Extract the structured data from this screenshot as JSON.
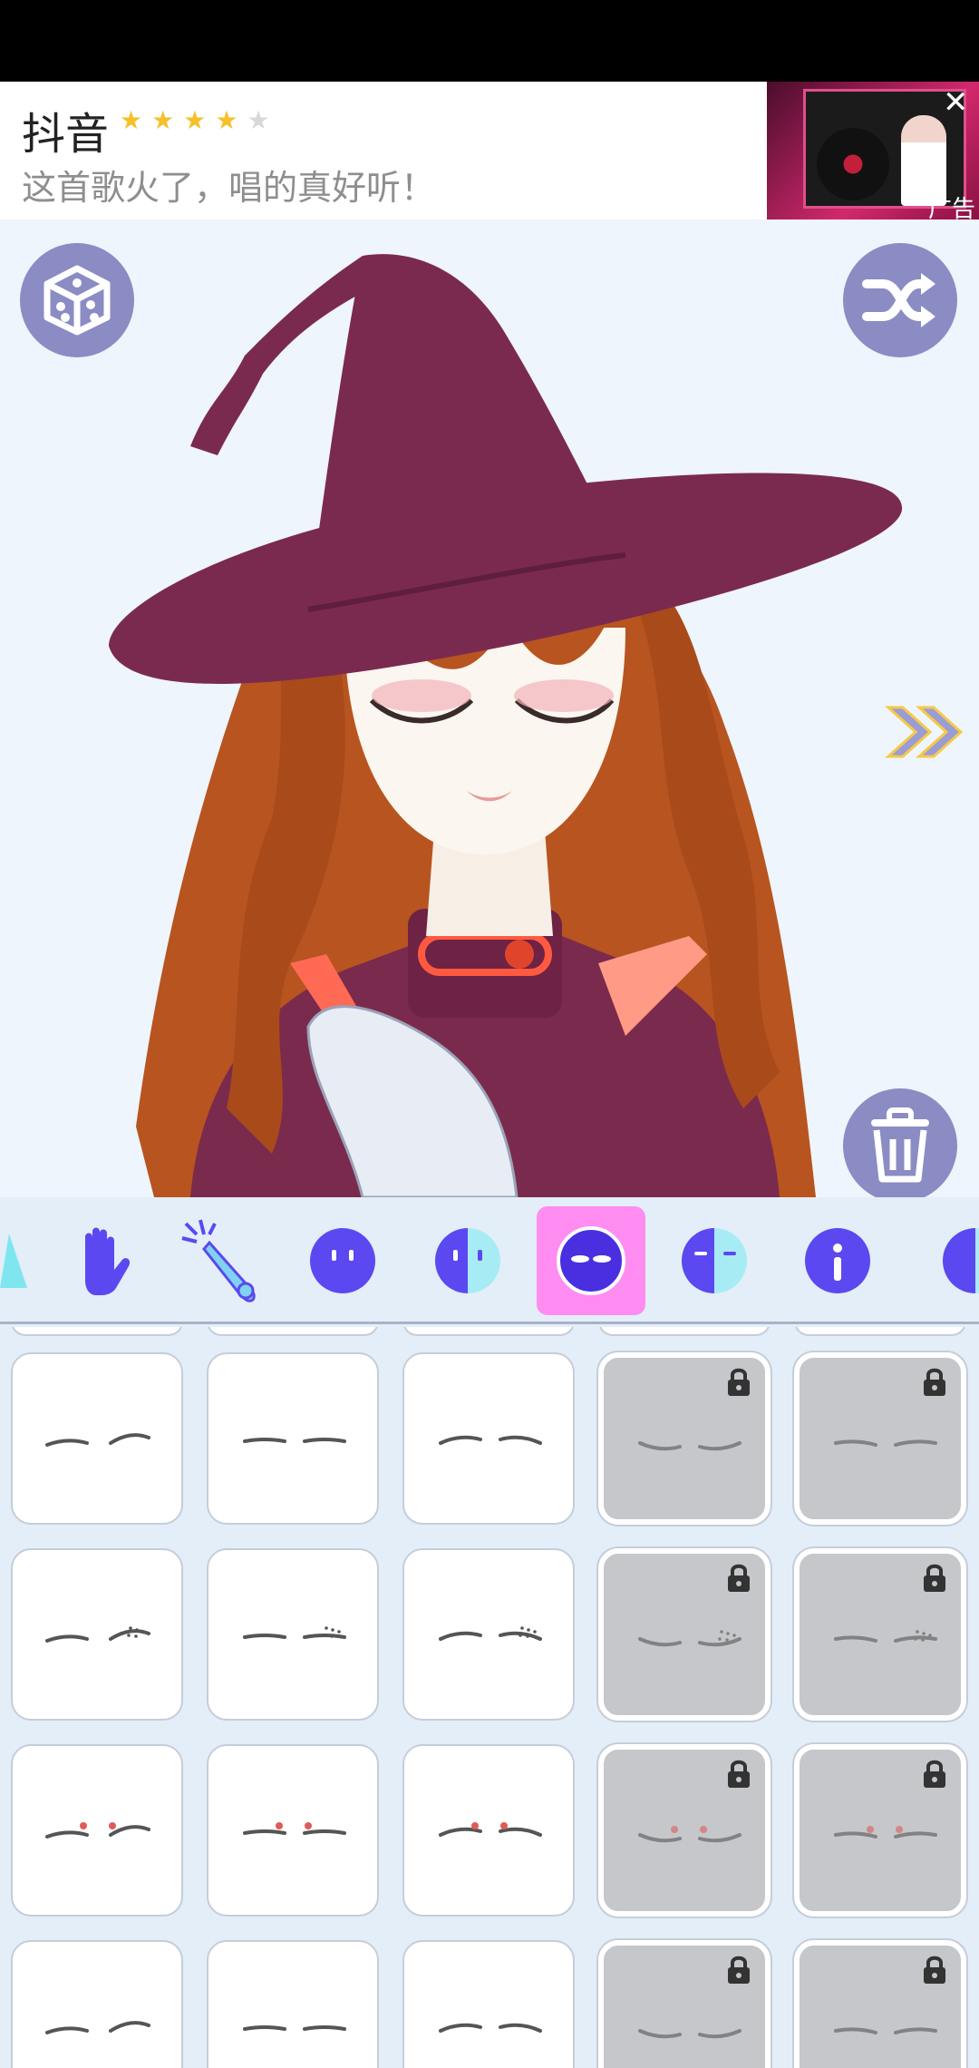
{
  "ad": {
    "app_name": "抖音",
    "rating_stars": 4,
    "rating_max": 5,
    "subtitle": "这首歌火了，唱的真好听！",
    "tag": "广告",
    "close_icon": "close-icon",
    "colors": {
      "star_on": "#f5c02a",
      "star_off": "#d8d8d8"
    }
  },
  "canvas": {
    "buttons": {
      "random": "dice-icon",
      "shuffle": "shuffle-icon",
      "next": "double-chevron-right-icon",
      "delete": "trash-icon"
    },
    "colors": {
      "button_bg": "#8b8cc4",
      "hat": "#7b2a4f",
      "hair": "#b8541f",
      "robe": "#7a2a4d"
    }
  },
  "toolbar": {
    "tools": [
      {
        "icon": "partial-tool-icon",
        "active": false
      },
      {
        "icon": "hand-icon",
        "active": false
      },
      {
        "icon": "magic-wand-icon",
        "active": false
      },
      {
        "icon": "face-icon",
        "active": false
      },
      {
        "icon": "half-face-icon",
        "active": false
      },
      {
        "icon": "eyes-glow-icon",
        "active": true
      },
      {
        "icon": "face-side-icon",
        "active": false
      },
      {
        "icon": "info-face-icon",
        "active": false
      },
      {
        "icon": "partial-face-icon",
        "active": false
      }
    ],
    "colors": {
      "icon": "#5b48f0",
      "active_bg": "#ff8cf0"
    }
  },
  "eyebrow_grid": {
    "columns": 5,
    "rows": [
      [
        {
          "style": "brow-plain-a",
          "locked": false
        },
        {
          "style": "brow-plain-b",
          "locked": false
        },
        {
          "style": "brow-plain-c",
          "locked": false
        },
        {
          "style": "brow-plain-d",
          "locked": true
        },
        {
          "style": "brow-plain-e",
          "locked": true
        }
      ],
      [
        {
          "style": "brow-dotted-a",
          "locked": false
        },
        {
          "style": "brow-dotted-b",
          "locked": false
        },
        {
          "style": "brow-dotted-c",
          "locked": false
        },
        {
          "style": "brow-dotted-d",
          "locked": true
        },
        {
          "style": "brow-dotted-e",
          "locked": true
        }
      ],
      [
        {
          "style": "brow-red-a",
          "locked": false
        },
        {
          "style": "brow-red-b",
          "locked": false
        },
        {
          "style": "brow-red-c",
          "locked": false
        },
        {
          "style": "brow-red-d",
          "locked": true
        },
        {
          "style": "brow-red-e",
          "locked": true
        }
      ],
      [
        {
          "style": "brow-flat-a",
          "locked": false
        },
        {
          "style": "brow-flat-b",
          "locked": false
        },
        {
          "style": "brow-flat-c",
          "locked": false
        },
        {
          "style": "brow-flat-d",
          "locked": true
        },
        {
          "style": "brow-flat-e",
          "locked": true
        }
      ]
    ]
  }
}
